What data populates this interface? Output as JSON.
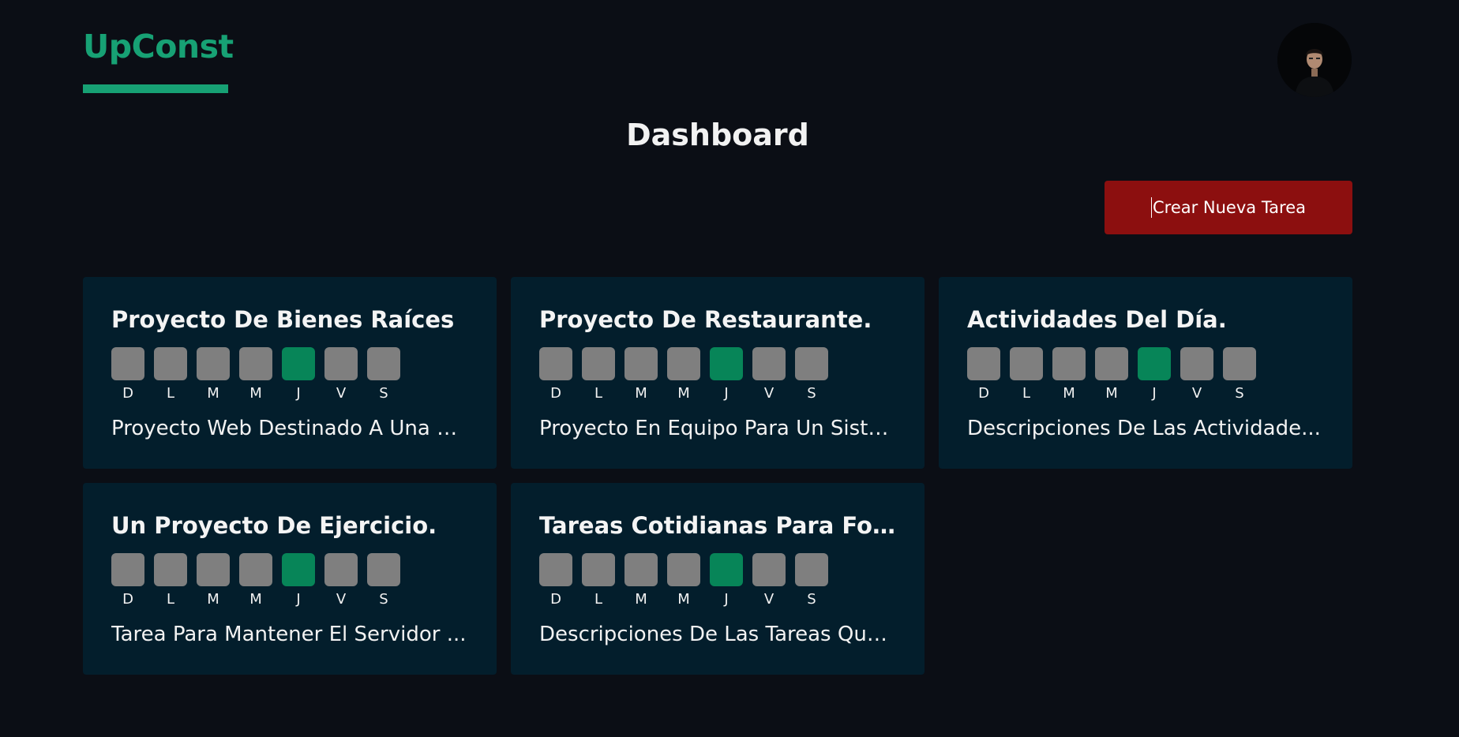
{
  "header": {
    "brand": "UpConst",
    "title": "Dashboard",
    "create_button": "Crear Nueva Tarea"
  },
  "day_labels": [
    "D",
    "L",
    "M",
    "M",
    "J",
    "V",
    "S"
  ],
  "colors": {
    "background": "#0b0e15",
    "brand": "#17a174",
    "card": "#031e2c",
    "day_inactive": "#7f7f7f",
    "day_active": "#078558",
    "create_button": "#8c0f0f"
  },
  "tasks": [
    {
      "title": "Proyecto De Bienes Raíces",
      "description": "Proyecto Web Destinado A Una E...",
      "active_day": "J"
    },
    {
      "title": "Proyecto De Restaurante.",
      "description": "Proyecto En Equipo Para Un Siste...",
      "active_day": "J"
    },
    {
      "title": "Actividades Del Día.",
      "description": "Descripciones De Las Actividade...",
      "active_day": "J"
    },
    {
      "title": "Un Proyecto De Ejercicio.",
      "description": "Tarea Para Mantener El Servidor ...",
      "active_day": "J"
    },
    {
      "title": "Tareas Cotidianas Para Fort...",
      "description": "Descripciones De Las Tareas Que...",
      "active_day": "J"
    }
  ]
}
